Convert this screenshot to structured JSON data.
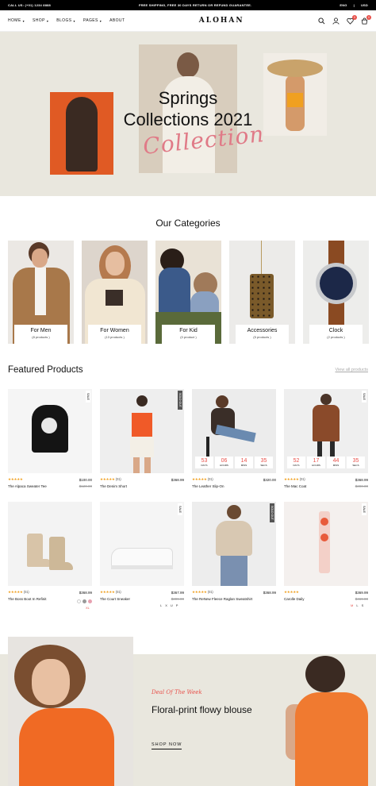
{
  "topbar": {
    "call": "CALL US: (+01) 1234 8888",
    "promo": "FREE SHIPPING, FREE 30 DAYS RETURN OR REFUND GUARANTEE.",
    "lang": "ENG",
    "currency": "USD"
  },
  "nav": {
    "home": "HOME",
    "shop": "SHOP",
    "blogs": "BLOGS",
    "pages": "PAGES",
    "about": "ABOUT",
    "logo": "ALOHAN",
    "wishlist_count": "0",
    "cart_count": "0"
  },
  "hero": {
    "line1": "Springs",
    "line2": "Collections 2021",
    "script": "Collection"
  },
  "categories": {
    "title": "Our Categories",
    "items": [
      {
        "name": "For Men",
        "count": "(8 products )"
      },
      {
        "name": "For Women",
        "count": "(13 products )"
      },
      {
        "name": "For Kid",
        "count": "(0 product )"
      },
      {
        "name": "Accessories",
        "count": "(5 products )"
      },
      {
        "name": "Clock",
        "count": "(2 products )"
      }
    ]
  },
  "featured": {
    "title": "Featured Products",
    "view_all": "View all products",
    "products": [
      {
        "name": "The Alpaca Sweater Tee",
        "price": "$100.00",
        "old": "$120.00",
        "stars": "★★★★★",
        "reviews": "",
        "tag": "SALE"
      },
      {
        "name": "The Denim Short",
        "price": "$368.99",
        "old": "",
        "stars": "★★★★★",
        "reviews": "(01)",
        "tag": "SOLD OUT"
      },
      {
        "name": "The Leather Slip-On",
        "price": "$320.00",
        "old": "",
        "stars": "★★★★★",
        "reviews": "(01)",
        "tag": ""
      },
      {
        "name": "The Mac Coat",
        "price": "$368.99",
        "old": "$390.00",
        "stars": "★★★★★",
        "reviews": "(01)",
        "tag": "SALE"
      },
      {
        "name": "The Boss Boot In Refinit",
        "price": "$368.99",
        "old": "",
        "stars": "★★★★★",
        "reviews": "(01)",
        "tag": ""
      },
      {
        "name": "The Court Sneaker",
        "price": "$367.99",
        "old": "$399.00",
        "stars": "★★★★★",
        "reviews": "(01)",
        "tag": "SALE"
      },
      {
        "name": "The ReNew Fleece Raglan Sweatshirt",
        "price": "$368.99",
        "old": "",
        "stars": "★★★★★",
        "reviews": "(01)",
        "tag": "SOLD OUT"
      },
      {
        "name": "Carolle Daily",
        "price": "$369.99",
        "old": "$469.00",
        "stars": "★★★★★",
        "reviews": "",
        "tag": "SALE"
      }
    ],
    "countdown_a": {
      "days": "53",
      "hours": "06",
      "mins": "14",
      "secs": "35"
    },
    "countdown_b": {
      "days": "52",
      "hours": "17",
      "mins": "44",
      "secs": "35"
    },
    "units": {
      "days": "DAYS",
      "hours": "HOURS",
      "mins": "MINS",
      "secs": "SECS"
    },
    "sizes_boot": [
      "XL"
    ],
    "sizes_sneaker": [
      "L",
      "X",
      "U",
      "P"
    ],
    "sizes_daily": [
      "M",
      "L",
      "S"
    ]
  },
  "deal": {
    "sub": "Deal Of The Week",
    "headline": "Floral-print flowy blouse",
    "cta": "SHOP NOW"
  }
}
